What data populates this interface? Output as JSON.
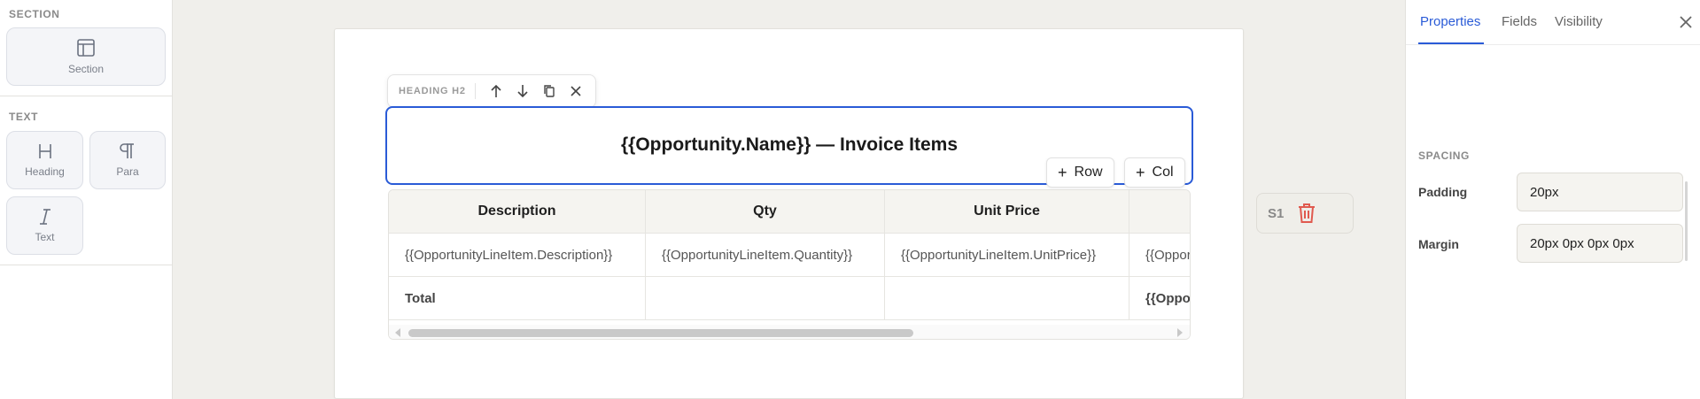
{
  "palette": {
    "section_title": "SECTION",
    "section_tile": "Section",
    "text_title": "TEXT",
    "heading_tile": "Heading",
    "para_tile": "Para",
    "text_tile": "Text"
  },
  "canvas": {
    "toolbar_label": "HEADING H2",
    "heading_text": "{{Opportunity.Name}} — Invoice Items",
    "add_row": "Row",
    "add_col": "Col",
    "table": {
      "headers": [
        "Description",
        "Qty",
        "Unit Price",
        ""
      ],
      "rows": [
        [
          "{{OpportunityLineItem.Description}}",
          "{{OpportunityLineItem.Quantity}}",
          "{{OpportunityLineItem.UnitPrice}}",
          "{{OpportunityLineItem.TotalPrice}}"
        ],
        [
          "Total",
          "",
          "",
          "{{Opportunity.Amount}}"
        ]
      ]
    },
    "section_badge": "S1"
  },
  "properties": {
    "tabs": [
      "Properties",
      "Fields",
      "Visibility"
    ],
    "active_tab": "Properties",
    "group_title": "SPACING",
    "padding_label": "Padding",
    "padding_value": "20px",
    "margin_label": "Margin",
    "margin_value": "20px 0px 0px 0px"
  },
  "colors": {
    "accent": "#2a5bd7",
    "delete": "#e05a4f"
  }
}
